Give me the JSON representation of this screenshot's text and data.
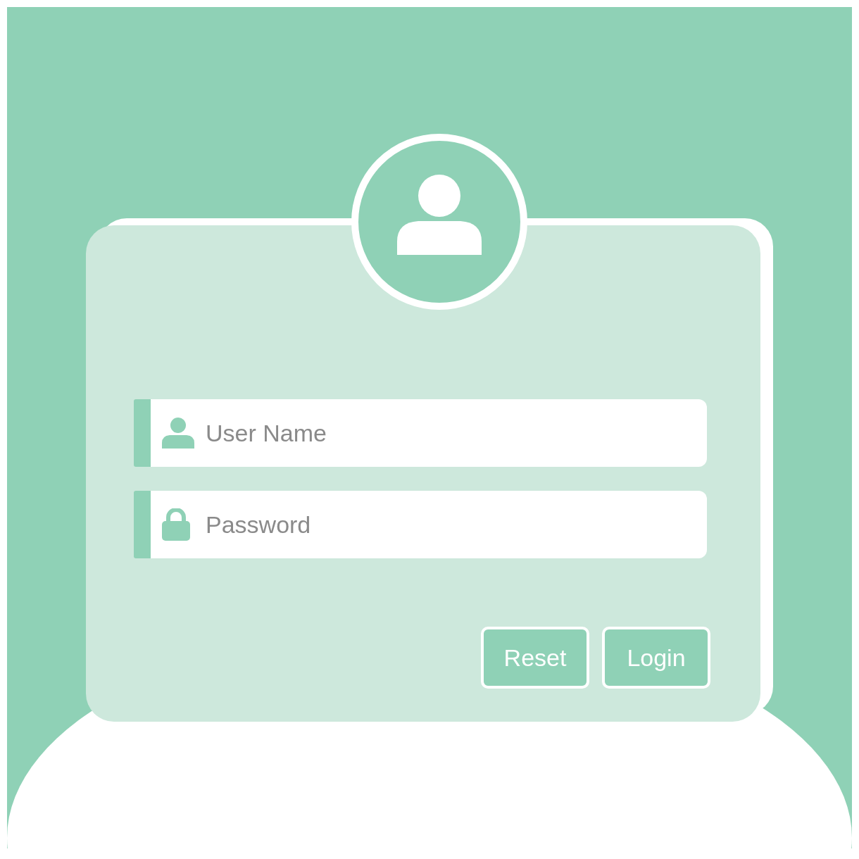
{
  "username_field": {
    "placeholder": "User Name"
  },
  "password_field": {
    "placeholder": "Password"
  },
  "buttons": [
    {
      "label": "Reset"
    },
    {
      "label": "Login"
    }
  ]
}
